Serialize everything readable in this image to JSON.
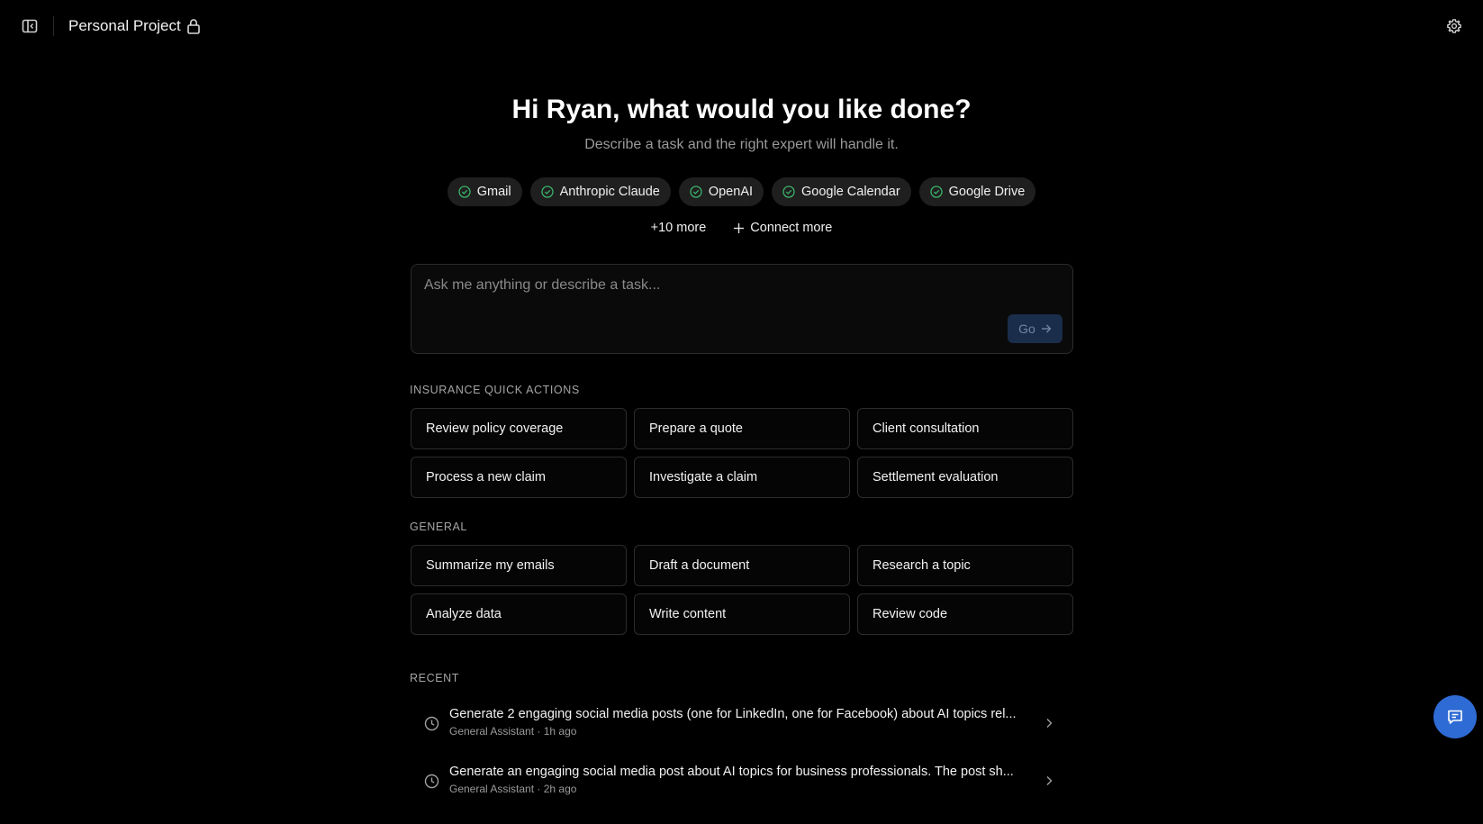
{
  "header": {
    "project_title": "Personal Project"
  },
  "hero": {
    "title": "Hi Ryan, what would you like done?",
    "subtitle": "Describe a task and the right expert will handle it."
  },
  "integrations": {
    "connected": [
      {
        "label": "Gmail",
        "status_icon": "check-circle-icon"
      },
      {
        "label": "Anthropic Claude",
        "status_icon": "check-circle-icon"
      },
      {
        "label": "OpenAI",
        "status_icon": "check-circle-icon"
      },
      {
        "label": "Google Calendar",
        "status_icon": "check-circle-icon"
      },
      {
        "label": "Google Drive",
        "status_icon": "check-circle-icon"
      }
    ],
    "more_label": "+10 more",
    "connect_label": "Connect more"
  },
  "task_input": {
    "placeholder": "Ask me anything or describe a task...",
    "value": "",
    "go_label": "Go"
  },
  "insurance": {
    "label": "INSURANCE QUICK ACTIONS",
    "actions": [
      "Review policy coverage",
      "Prepare a quote",
      "Client consultation",
      "Process a new claim",
      "Investigate a claim",
      "Settlement evaluation"
    ]
  },
  "general": {
    "label": "GENERAL",
    "actions": [
      "Summarize my emails",
      "Draft a document",
      "Research a topic",
      "Analyze data",
      "Write content",
      "Review code"
    ]
  },
  "recent": {
    "label": "RECENT",
    "items": [
      {
        "title": "Generate 2 engaging social media posts (one for LinkedIn, one for Facebook) about AI topics rel...",
        "meta": "General Assistant · 1h ago"
      },
      {
        "title": "Generate an engaging social media post about AI topics for business professionals. The post sh...",
        "meta": "General Assistant · 2h ago"
      }
    ]
  },
  "colors": {
    "background": "#000000",
    "accent": "#2f6bd4",
    "success": "#3bb26b"
  }
}
